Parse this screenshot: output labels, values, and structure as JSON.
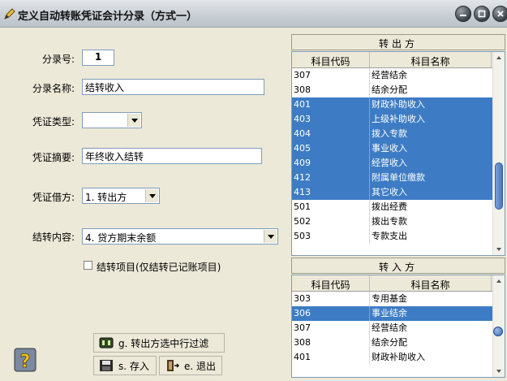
{
  "window": {
    "title": "定义自动转账凭证会计分录（方式一）"
  },
  "form": {
    "entry_no_label": "分录号:",
    "entry_no_value": "1",
    "entry_name_label": "分录名称:",
    "entry_name_value": "结转收入",
    "voucher_type_label": "凭证类型:",
    "voucher_type_value": "",
    "voucher_summary_label": "凭证摘要:",
    "voucher_summary_value": "年终收入结转",
    "debit_label": "凭证借方:",
    "debit_value": "1.  转出方",
    "content_label": "结转内容:",
    "content_value": "4.  贷方期末余额",
    "carry_item_label": "结转项目(仅结转已记账项目)"
  },
  "out_panel": {
    "title": "转出方",
    "col_code": "科目代码",
    "col_name": "科目名称",
    "rows": [
      {
        "code": "307",
        "name": "经营结余",
        "selected": false
      },
      {
        "code": "308",
        "name": "结余分配",
        "selected": false
      },
      {
        "code": "401",
        "name": "财政补助收入",
        "selected": true
      },
      {
        "code": "403",
        "name": "上级补助收入",
        "selected": true
      },
      {
        "code": "404",
        "name": "拨入专款",
        "selected": true
      },
      {
        "code": "405",
        "name": "事业收入",
        "selected": true
      },
      {
        "code": "409",
        "name": "经营收入",
        "selected": true
      },
      {
        "code": "412",
        "name": "附属单位缴款",
        "selected": true
      },
      {
        "code": "413",
        "name": "其它收入",
        "selected": true
      },
      {
        "code": "501",
        "name": "拨出经费",
        "selected": false
      },
      {
        "code": "502",
        "name": "拨出专款",
        "selected": false
      },
      {
        "code": "503",
        "name": "专款支出",
        "selected": false
      }
    ]
  },
  "in_panel": {
    "title": "转入方",
    "col_code": "科目代码",
    "col_name": "科目名称",
    "rows": [
      {
        "code": "303",
        "name": "专用基金",
        "selected": false
      },
      {
        "code": "306",
        "name": "事业结余",
        "selected": true
      },
      {
        "code": "307",
        "name": "经营结余",
        "selected": false
      },
      {
        "code": "308",
        "name": "结余分配",
        "selected": false
      },
      {
        "code": "401",
        "name": "财政补助收入",
        "selected": false
      }
    ]
  },
  "buttons": {
    "filter_label": "g. 转出方选中行过滤",
    "save_label": "s. 存入",
    "exit_label": "e. 退出"
  },
  "colors": {
    "selection": "#3d7cc4",
    "background": "#ece9d8"
  },
  "icons": {
    "app": "pen-icon",
    "help": "help-icon",
    "save": "floppy-disk-icon",
    "exit": "exit-door-icon",
    "filter": "filter-icon"
  }
}
